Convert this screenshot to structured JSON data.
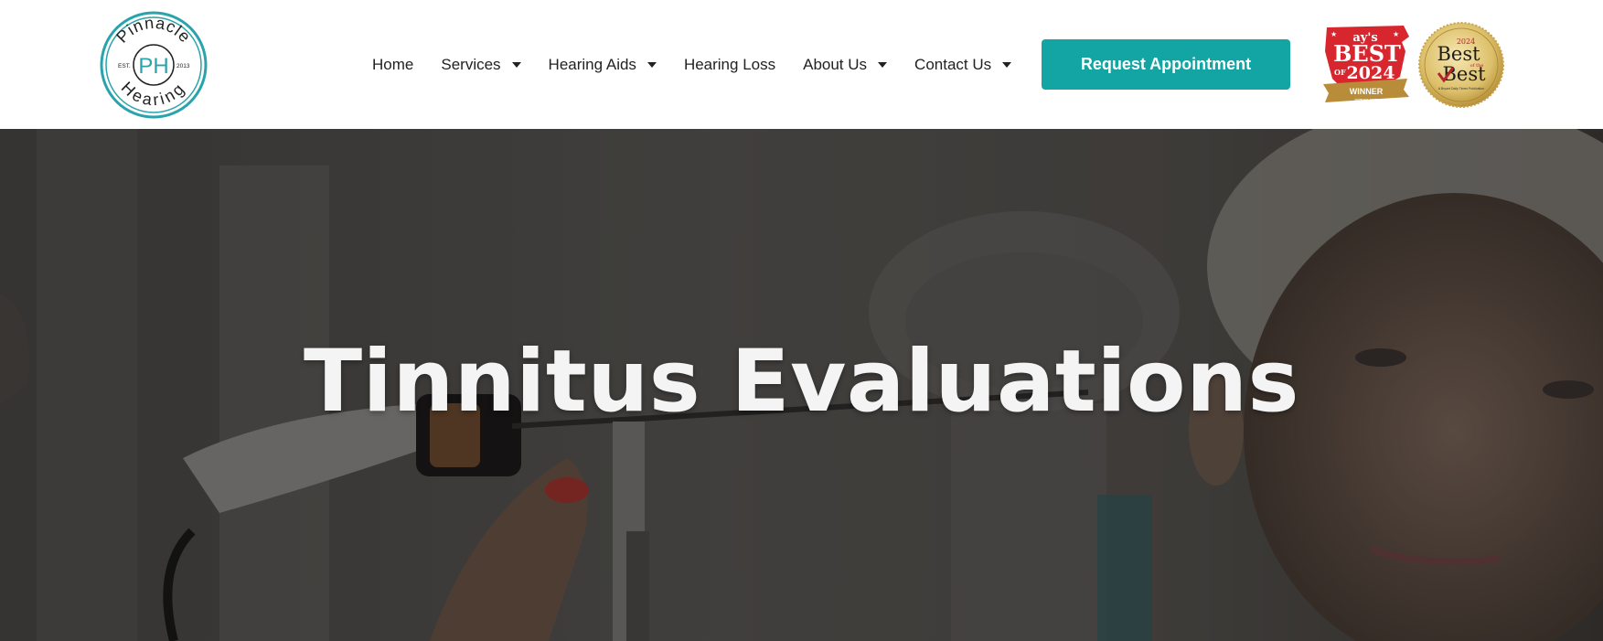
{
  "logo": {
    "name_top": "Pinnacle",
    "name_bottom": "Hearing",
    "initials": "PH",
    "est_label": "EST.",
    "est_year": "2013",
    "color": "#2aa3aa"
  },
  "nav": {
    "items": [
      {
        "label": "Home",
        "has_dropdown": false
      },
      {
        "label": "Services",
        "has_dropdown": true
      },
      {
        "label": "Hearing Aids",
        "has_dropdown": true
      },
      {
        "label": "Hearing Loss",
        "has_dropdown": false
      },
      {
        "label": "About Us",
        "has_dropdown": true
      },
      {
        "label": "Contact Us",
        "has_dropdown": true
      }
    ]
  },
  "cta": {
    "label": "Request Appointment",
    "color": "#12a5a3"
  },
  "badges": {
    "best_of": {
      "line1": "ay's",
      "line2": "BEST",
      "line3": "OF",
      "line4": "2024",
      "ribbon": "WINNER",
      "url": "aymag.com"
    },
    "seal": {
      "year": "2024",
      "line1": "Best",
      "line2": "of the",
      "line3": "Best",
      "caption": "A Bryant Daily Times Publication"
    }
  },
  "hero": {
    "title": "Tinnitus Evaluations"
  }
}
